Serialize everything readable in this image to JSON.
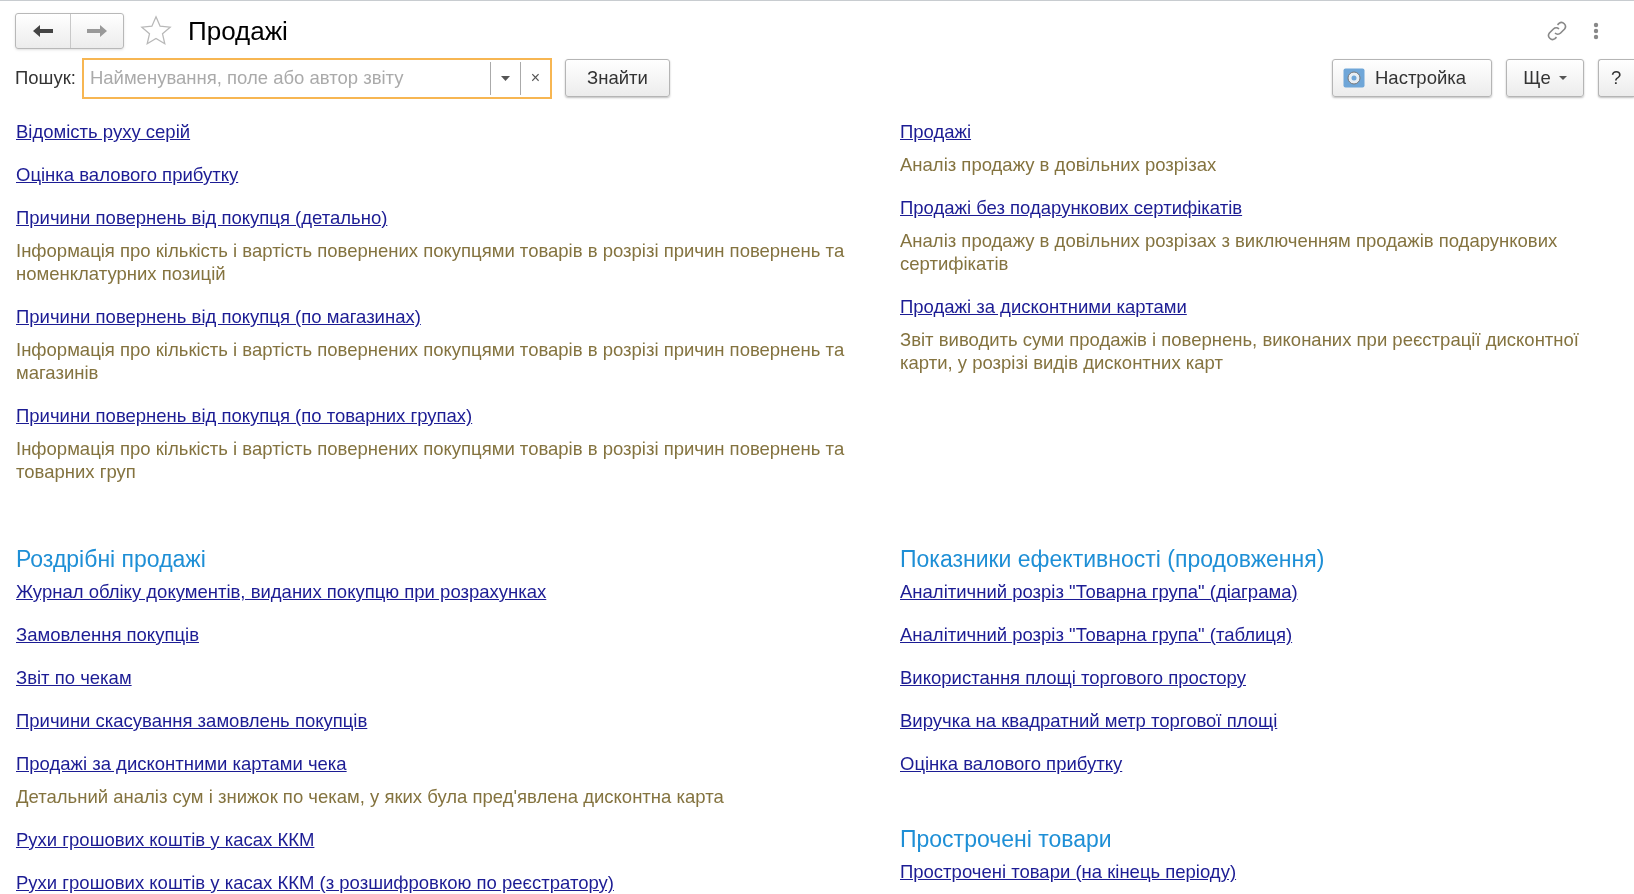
{
  "window": {
    "title": "Продажі",
    "favorite": false
  },
  "search": {
    "label": "Пошук:",
    "placeholder": "Найменування, поле або автор звіту",
    "clear": "×",
    "find_button": "Знайти"
  },
  "toolbar": {
    "settings_button": "Настройка",
    "more_button": "Ще",
    "help_button": "?"
  },
  "rows": [
    {
      "columns": [
        [
          {
            "items": [
              {
                "title": "Відомість руху серій"
              },
              {
                "title": "Оцінка валового прибутку"
              },
              {
                "title": "Причини повернень від покупця (детально)",
                "description": "Інформація про кількість і вартість повернених покупцями товарів в розрізі причин повернень та номенклатурних позицій"
              },
              {
                "title": "Причини повернень від покупця (по магазинах)",
                "description": "Інформація про кількість і вартість повернених покупцями товарів в розрізі причин повернень та магазинів"
              },
              {
                "title": "Причини повернень від покупця (по товарних групах)",
                "description": "Інформація про кількість і вартість повернених покупцями товарів в розрізі причин повернень та товарних груп"
              }
            ]
          }
        ],
        [
          {
            "items": [
              {
                "title": "Продажі",
                "description": "Аналіз продажу в довільних розрізах"
              },
              {
                "title": "Продажі без подарункових сертифікатів",
                "description": "Аналіз продажу в довільних розрізах з виключенням продажів подарункових сертифікатів"
              },
              {
                "title": "Продажі за дисконтними картами",
                "description": "Звіт виводить суми продажів і повернень, виконаних при реєстрації дисконтної карти, у розрізі видів дисконтних карт"
              }
            ]
          }
        ]
      ]
    },
    {
      "columns": [
        [
          {
            "heading": "Роздрібні продажі",
            "items": [
              {
                "title": "Журнал обліку документів, виданих покупцю при розрахунках"
              },
              {
                "title": "Замовлення покупців"
              },
              {
                "title": "Звіт по чекам"
              },
              {
                "title": "Причини скасування замовлень покупців"
              },
              {
                "title": "Продажі за дисконтними картами чека",
                "description": "Детальний аналіз сум і знижок по чекам, у яких була пред'явлена дисконтна карта"
              },
              {
                "title": "Рухи грошових коштів у касах ККМ"
              },
              {
                "title": "Рухи грошових коштів у касах ККМ (з розшифровкою по реєстратору)"
              }
            ]
          }
        ],
        [
          {
            "heading": "Показники ефективності (продовження)",
            "items": [
              {
                "title": "Аналітичний розріз \"Товарна група\" (діаграма)"
              },
              {
                "title": "Аналітичний розріз \"Товарна група\" (таблиця)"
              },
              {
                "title": "Використання площі торгового простору"
              },
              {
                "title": "Виручка на квадратний метр торгової площі"
              },
              {
                "title": "Оцінка валового прибутку"
              }
            ]
          },
          {
            "heading": "Прострочені товари",
            "items": [
              {
                "title": "Прострочені товари (на кінець періоду)"
              }
            ]
          }
        ]
      ]
    }
  ]
}
